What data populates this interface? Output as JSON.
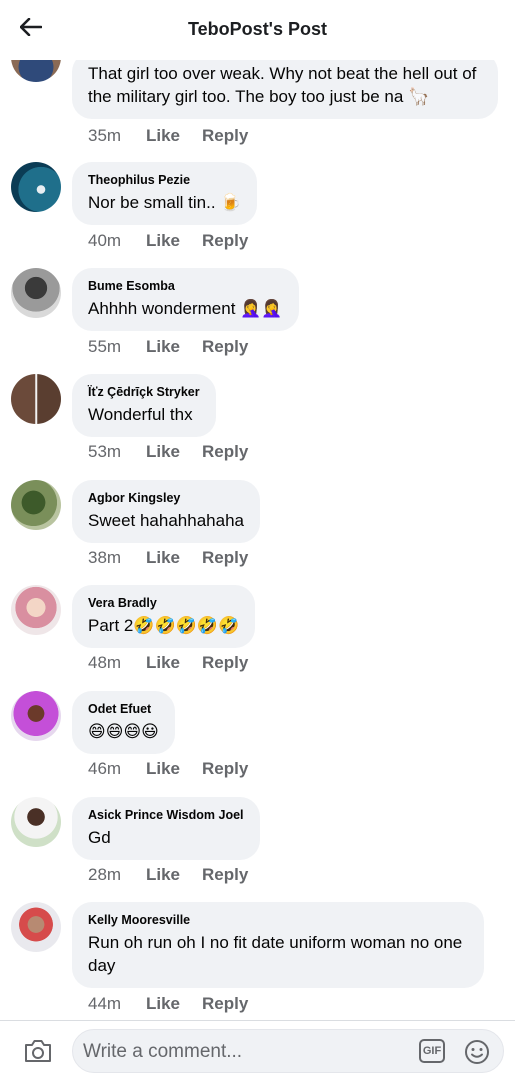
{
  "header": {
    "title": "TeboPost's Post"
  },
  "comments": [
    {
      "author": "",
      "text": "That girl too over weak. Why not beat the hell out of the military girl too. The boy too just be na 🦙",
      "time": "35m",
      "like": "Like",
      "reply": "Reply"
    },
    {
      "author": "Theophilus Pezie",
      "text": "Nor be small tin.. 🍺",
      "time": "40m",
      "like": "Like",
      "reply": "Reply"
    },
    {
      "author": "Bume Esomba",
      "text": "Ahhhh wonderment 🤦‍♀️🤦‍♀️",
      "time": "55m",
      "like": "Like",
      "reply": "Reply"
    },
    {
      "author": "Ïťz Çēdrīçk Stryker",
      "text": "Wonderful thx",
      "time": "53m",
      "like": "Like",
      "reply": "Reply"
    },
    {
      "author": "Agbor Kingsley",
      "text": "Sweet hahahhahaha",
      "time": "38m",
      "like": "Like",
      "reply": "Reply"
    },
    {
      "author": "Vera Bradly",
      "text": "Part 2🤣🤣🤣🤣🤣",
      "time": "48m",
      "like": "Like",
      "reply": "Reply"
    },
    {
      "author": "Odet Efuet",
      "text": "😄😄😄😃",
      "time": "46m",
      "like": "Like",
      "reply": "Reply"
    },
    {
      "author": "Asick Prince Wisdom Joel",
      "text": "Gd",
      "time": "28m",
      "like": "Like",
      "reply": "Reply"
    },
    {
      "author": "Kelly Mooresville",
      "text": "Run oh run oh I no fit date uniform woman no one day",
      "time": "44m",
      "like": "Like",
      "reply": "Reply"
    }
  ],
  "composer": {
    "placeholder": "Write a comment...",
    "gif_label": "GIF"
  },
  "icons": {
    "back": "back-arrow-icon",
    "camera": "camera-icon",
    "emoji": "smiley-icon"
  }
}
